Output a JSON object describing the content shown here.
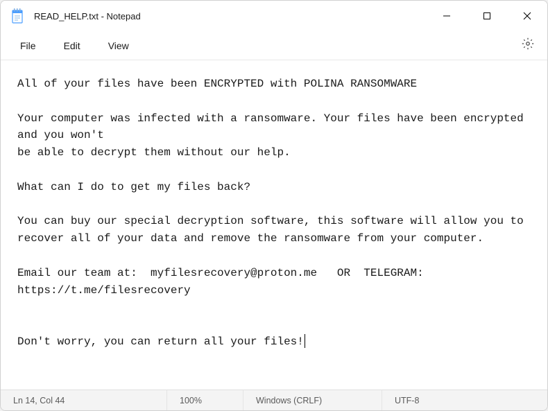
{
  "titlebar": {
    "title": "READ_HELP.txt - Notepad"
  },
  "menu": {
    "file": "File",
    "edit": "Edit",
    "view": "View"
  },
  "content": {
    "text": "All of your files have been ENCRYPTED with POLINA RANSOMWARE\n\nYour computer was infected with a ransomware. Your files have been encrypted and you won't\nbe able to decrypt them without our help.\n\nWhat can I do to get my files back?\n\nYou can buy our special decryption software, this software will allow you to recover all of your data and remove the ransomware from your computer.\n\nEmail our team at:  myfilesrecovery@proton.me   OR  TELEGRAM: https://t.me/filesrecovery\n\n\nDon't worry, you can return all your files!"
  },
  "statusbar": {
    "position": "Ln 14, Col 44",
    "zoom": "100%",
    "lineEnding": "Windows (CRLF)",
    "encoding": "UTF-8"
  }
}
